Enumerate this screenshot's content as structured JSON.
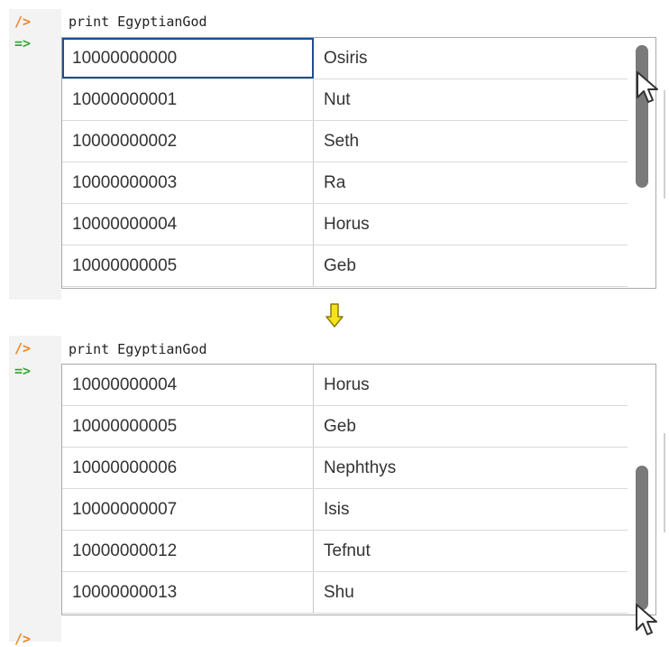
{
  "prompts": {
    "input": "/>",
    "output": "=>"
  },
  "panels": [
    {
      "command": "print EgyptianGod",
      "rows": [
        {
          "id": "10000000000",
          "name": "Osiris"
        },
        {
          "id": "10000000001",
          "name": "Nut"
        },
        {
          "id": "10000000002",
          "name": "Seth"
        },
        {
          "id": "10000000003",
          "name": "Ra"
        },
        {
          "id": "10000000004",
          "name": "Horus"
        },
        {
          "id": "10000000005",
          "name": "Geb"
        }
      ]
    },
    {
      "command": "print EgyptianGod",
      "rows": [
        {
          "id": "10000000004",
          "name": "Horus"
        },
        {
          "id": "10000000005",
          "name": "Geb"
        },
        {
          "id": "10000000006",
          "name": "Nephthys"
        },
        {
          "id": "10000000007",
          "name": "Isis"
        },
        {
          "id": "10000000012",
          "name": "Tefnut"
        },
        {
          "id": "10000000013",
          "name": "Shu"
        }
      ]
    }
  ],
  "transition_icon": "arrow-down-icon",
  "colors": {
    "input_prompt": "#e8862a",
    "output_prompt": "#3aa83a",
    "selection": "#1f4d8f",
    "transition_arrow": "#f5e21b"
  }
}
